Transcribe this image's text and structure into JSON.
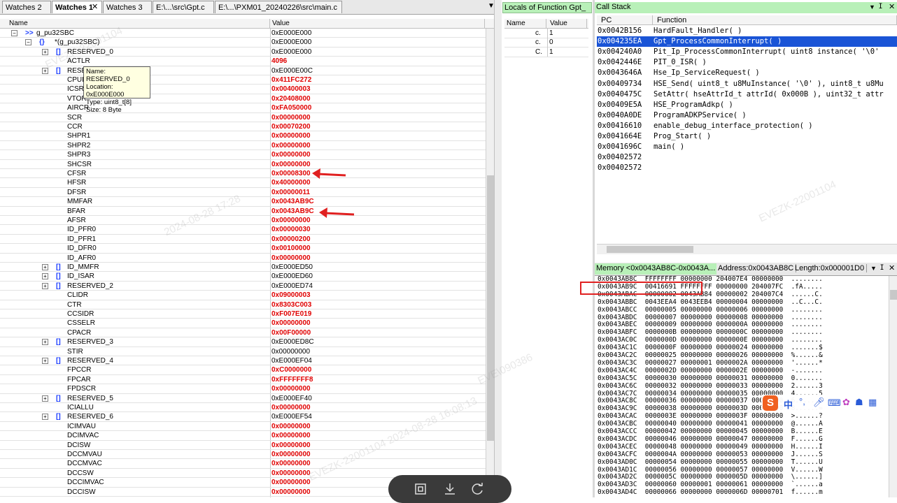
{
  "watch_tabs": [
    "Watches 2",
    "Watches 1",
    "Watches 3",
    "E:\\...\\src\\Gpt.c",
    "E:\\...\\PXM01_20240226\\src\\main.c"
  ],
  "watch_columns": {
    "name": "Name",
    "value": "Value"
  },
  "watch_rows": [
    {
      "name": "g_pu32SBC",
      "value": "0xE000E000",
      "indent": 0,
      "expander": "minus",
      "icon": ">>",
      "red": false
    },
    {
      "name": "*(g_pu32SBC)",
      "value": "0xE000E000",
      "indent": 1,
      "expander": "minus",
      "icon": "{}",
      "red": false
    },
    {
      "name": "RESERVED_0",
      "value": "0xE000E000",
      "indent": 2,
      "expander": "plus",
      "icon": "[]",
      "red": false
    },
    {
      "name": "ACTLR",
      "value": "4096",
      "indent": 3,
      "expander": "",
      "icon": "",
      "red": true
    },
    {
      "name": "RESE",
      "value": "0xE000E00C",
      "indent": 2,
      "expander": "plus",
      "icon": "[]",
      "red": false
    },
    {
      "name": "CPUI",
      "value": "0x411FC272",
      "indent": 3,
      "expander": "",
      "icon": "",
      "red": true
    },
    {
      "name": "ICSR",
      "value": "0x00400003",
      "indent": 3,
      "expander": "",
      "icon": "",
      "red": true
    },
    {
      "name": "VTOR",
      "value": "0x20408000",
      "indent": 3,
      "expander": "",
      "icon": "",
      "red": true
    },
    {
      "name": "AIRCR",
      "value": "0xFA050000",
      "indent": 3,
      "expander": "",
      "icon": "",
      "red": true
    },
    {
      "name": "SCR",
      "value": "0x00000000",
      "indent": 3,
      "expander": "",
      "icon": "",
      "red": true
    },
    {
      "name": "CCR",
      "value": "0x00070200",
      "indent": 3,
      "expander": "",
      "icon": "",
      "red": true
    },
    {
      "name": "SHPR1",
      "value": "0x00000000",
      "indent": 3,
      "expander": "",
      "icon": "",
      "red": true
    },
    {
      "name": "SHPR2",
      "value": "0x00000000",
      "indent": 3,
      "expander": "",
      "icon": "",
      "red": true
    },
    {
      "name": "SHPR3",
      "value": "0x00000000",
      "indent": 3,
      "expander": "",
      "icon": "",
      "red": true
    },
    {
      "name": "SHCSR",
      "value": "0x00000000",
      "indent": 3,
      "expander": "",
      "icon": "",
      "red": true
    },
    {
      "name": "CFSR",
      "value": "0x00008300",
      "indent": 3,
      "expander": "",
      "icon": "",
      "red": true
    },
    {
      "name": "HFSR",
      "value": "0x40000000",
      "indent": 3,
      "expander": "",
      "icon": "",
      "red": true
    },
    {
      "name": "DFSR",
      "value": "0x00000011",
      "indent": 3,
      "expander": "",
      "icon": "",
      "red": true
    },
    {
      "name": "MMFAR",
      "value": "0x0043AB9C",
      "indent": 3,
      "expander": "",
      "icon": "",
      "red": true
    },
    {
      "name": "BFAR",
      "value": "0x0043AB9C",
      "indent": 3,
      "expander": "",
      "icon": "",
      "red": true
    },
    {
      "name": "AFSR",
      "value": "0x00000000",
      "indent": 3,
      "expander": "",
      "icon": "",
      "red": true
    },
    {
      "name": "ID_PFR0",
      "value": "0x00000030",
      "indent": 3,
      "expander": "",
      "icon": "",
      "red": true
    },
    {
      "name": "ID_PFR1",
      "value": "0x00000200",
      "indent": 3,
      "expander": "",
      "icon": "",
      "red": true
    },
    {
      "name": "ID_DFR0",
      "value": "0x00100000",
      "indent": 3,
      "expander": "",
      "icon": "",
      "red": true
    },
    {
      "name": "ID_AFR0",
      "value": "0x00000000",
      "indent": 3,
      "expander": "",
      "icon": "",
      "red": true
    },
    {
      "name": "ID_MMFR",
      "value": "0xE000ED50",
      "indent": 2,
      "expander": "plus",
      "icon": "[]",
      "red": false
    },
    {
      "name": "ID_ISAR",
      "value": "0xE000ED60",
      "indent": 2,
      "expander": "plus",
      "icon": "[]",
      "red": false
    },
    {
      "name": "RESERVED_2",
      "value": "0xE000ED74",
      "indent": 2,
      "expander": "plus",
      "icon": "[]",
      "red": false
    },
    {
      "name": "CLIDR",
      "value": "0x09000003",
      "indent": 3,
      "expander": "",
      "icon": "",
      "red": true
    },
    {
      "name": "CTR",
      "value": "0x8303C003",
      "indent": 3,
      "expander": "",
      "icon": "",
      "red": true
    },
    {
      "name": "CCSIDR",
      "value": "0xF007E019",
      "indent": 3,
      "expander": "",
      "icon": "",
      "red": true
    },
    {
      "name": "CSSELR",
      "value": "0x00000000",
      "indent": 3,
      "expander": "",
      "icon": "",
      "red": true
    },
    {
      "name": "CPACR",
      "value": "0x00F00000",
      "indent": 3,
      "expander": "",
      "icon": "",
      "red": true
    },
    {
      "name": "RESERVED_3",
      "value": "0xE000ED8C",
      "indent": 2,
      "expander": "plus",
      "icon": "[]",
      "red": false
    },
    {
      "name": "STIR",
      "value": "0x00000000",
      "indent": 3,
      "expander": "",
      "icon": "",
      "red": false
    },
    {
      "name": "RESERVED_4",
      "value": "0xE000EF04",
      "indent": 2,
      "expander": "plus",
      "icon": "[]",
      "red": false
    },
    {
      "name": "FPCCR",
      "value": "0xC0000000",
      "indent": 3,
      "expander": "",
      "icon": "",
      "red": true
    },
    {
      "name": "FPCAR",
      "value": "0xFFFFFFF8",
      "indent": 3,
      "expander": "",
      "icon": "",
      "red": true
    },
    {
      "name": "FPDSCR",
      "value": "0x00000000",
      "indent": 3,
      "expander": "",
      "icon": "",
      "red": true
    },
    {
      "name": "RESERVED_5",
      "value": "0xE000EF40",
      "indent": 2,
      "expander": "plus",
      "icon": "[]",
      "red": false
    },
    {
      "name": "ICIALLU",
      "value": "0x00000000",
      "indent": 3,
      "expander": "",
      "icon": "",
      "red": true
    },
    {
      "name": "RESERVED_6",
      "value": "0xE000EF54",
      "indent": 2,
      "expander": "plus",
      "icon": "[]",
      "red": false
    },
    {
      "name": "ICIMVAU",
      "value": "0x00000000",
      "indent": 3,
      "expander": "",
      "icon": "",
      "red": true
    },
    {
      "name": "DCIMVAC",
      "value": "0x00000000",
      "indent": 3,
      "expander": "",
      "icon": "",
      "red": true
    },
    {
      "name": "DCISW",
      "value": "0x00000000",
      "indent": 3,
      "expander": "",
      "icon": "",
      "red": true
    },
    {
      "name": "DCCMVAU",
      "value": "0x00000000",
      "indent": 3,
      "expander": "",
      "icon": "",
      "red": true
    },
    {
      "name": "DCCMVAC",
      "value": "0x00000000",
      "indent": 3,
      "expander": "",
      "icon": "",
      "red": true
    },
    {
      "name": "DCCSW",
      "value": "0x00000000",
      "indent": 3,
      "expander": "",
      "icon": "",
      "red": true
    },
    {
      "name": "DCCIMVAC",
      "value": "0x00000000",
      "indent": 3,
      "expander": "",
      "icon": "",
      "red": true
    },
    {
      "name": "DCCISW",
      "value": "0x00000000",
      "indent": 3,
      "expander": "",
      "icon": "",
      "red": true
    }
  ],
  "tooltip": [
    "Name: RESERVED_0",
    "Location: 0xE000E000",
    "Type: uint8_t[8]",
    "Size: 8 Byte"
  ],
  "locals": {
    "title": "Locals of Function Gpt_",
    "columns": {
      "name": "Name",
      "value": "Value"
    },
    "rows": [
      {
        "name": "c.",
        "value": "1"
      },
      {
        "name": "c.",
        "value": "0"
      },
      {
        "name": "C.",
        "value": "1"
      }
    ]
  },
  "callstack": {
    "title": "Call Stack",
    "columns": {
      "pc": "PC",
      "function": "Function"
    },
    "rows": [
      {
        "pc": "0x0042B156",
        "fn": "HardFault_Handler(  )",
        "selected": false
      },
      {
        "pc": "0x004235EA",
        "fn": "Gpt_ProcessCommonInterrupt(  )",
        "selected": true
      },
      {
        "pc": "0x004240A0",
        "fn": "Pit_Ip_ProcessCommonInterrupt( uint8 instance( '\\0'",
        "selected": false
      },
      {
        "pc": "0x0042446E",
        "fn": "PIT_0_ISR(  )",
        "selected": false
      },
      {
        "pc": "0x0043646A",
        "fn": "Hse_Ip_ServiceRequest(  )",
        "selected": false
      },
      {
        "pc": "0x00409734",
        "fn": "HSE_Send( uint8_t u8MuInstance( '\\0' ), uint8_t u8Mu",
        "selected": false
      },
      {
        "pc": "0x0040475C",
        "fn": "SetAttr( hseAttrId_t attrId( 0x000B ), uint32_t attr",
        "selected": false
      },
      {
        "pc": "0x00409E5A",
        "fn": "HSE_ProgramAdkp(  )",
        "selected": false
      },
      {
        "pc": "0x0040A0DE",
        "fn": "ProgramADKPService(  )",
        "selected": false
      },
      {
        "pc": "0x00416610",
        "fn": "enable_debug_interface_protection(  )",
        "selected": false
      },
      {
        "pc": "0x0041664E",
        "fn": "Prog_Start(  )",
        "selected": false
      },
      {
        "pc": "0x0041696C",
        "fn": "main(  )",
        "selected": false
      },
      {
        "pc": "0x00402572",
        "fn": "",
        "selected": false
      },
      {
        "pc": "0x00402572",
        "fn": "",
        "selected": false
      }
    ]
  },
  "memory": {
    "title": "Memory <0x0043AB8C-0x0043A...",
    "address_label": "Address:0x0043AB8C",
    "length_label": "Length:0x000001D0",
    "rows": [
      "0x0043AB8C  FFFFFFFF 00000000 204007E4 00000000  ........",
      "0x0043AB9C  00416691 FFFFFFFF 00000000 204007FC  .fA.....",
      "0x0043ABAC  00000002 0043AB84 00000002 204007C4  ......C.",
      "0x0043ABBC  0043EEA4 0043EEB4 00000004 00000000  ..C...C.",
      "0x0043ABCC  00000005 00000000 00000006 00000000  ........",
      "0x0043ABDC  00000007 00000000 00000008 00000000  ........",
      "0x0043ABEC  00000009 00000000 0000000A 00000000  ........",
      "0x0043ABFC  0000000B 00000000 0000000C 00000000  ........",
      "0x0043AC0C  0000000D 00000000 0000000E 00000000  ........",
      "0x0043AC1C  0000000F 00000000 00000024 00000000  .......$",
      "0x0043AC2C  00000025 00000000 00000026 00000000  %......&",
      "0x0043AC3C  00000027 00000001 0000002A 00000000  '......*",
      "0x0043AC4C  0000002D 00000000 0000002E 00000000  -.......",
      "0x0043AC5C  00000030 00000000 00000031 00000000  0.......",
      "0x0043AC6C  00000032 00000000 00000033 00000000  2......3",
      "0x0043AC7C  00000034 00000000 00000035 00000000  4......5",
      "0x0043AC8C  00000036 00000000 00000037 00000000  6......7",
      "0x0043AC9C  00000038 00000000 0000003D 00000000  8......=",
      "0x0043ACAC  0000003E 00000000 0000003F 00000000  >......?",
      "0x0043ACBC  00000040 00000000 00000041 00000000  @......A",
      "0x0043ACCC  00000042 00000000 00000045 00000000  B......E",
      "0x0043ACDC  00000046 00000000 00000047 00000000  F......G",
      "0x0043ACEC  00000048 00000000 00000049 00000000  H......I",
      "0x0043ACFC  0000004A 00000000 00000053 00000000  J......S",
      "0x0043AD0C  00000054 00000000 00000055 00000000  T......U",
      "0x0043AD1C  00000056 00000000 00000057 00000000  V......W",
      "0x0043AD2C  0000005C 00000000 0000005D 00000000  \\......]",
      "0x0043AD3C  00000060 00000001 00000061 00000000  `......a",
      "0x0043AD4C  00000066 00000000 0000006D 00000701  f......m"
    ]
  },
  "ime_toolbar": {
    "logo": "S",
    "lang": "中"
  },
  "watermark_text": [
    "EVEZK-22001104",
    "2024-08-28 17:28",
    "EVEZK-22001104 2024-08-28 16:08:13",
    "EVE\\090386"
  ],
  "colors": {
    "accent_green": "#b8f0b8",
    "selection_blue": "#1a54d6",
    "value_red": "#e00000",
    "annotation_red": "#e02020"
  }
}
